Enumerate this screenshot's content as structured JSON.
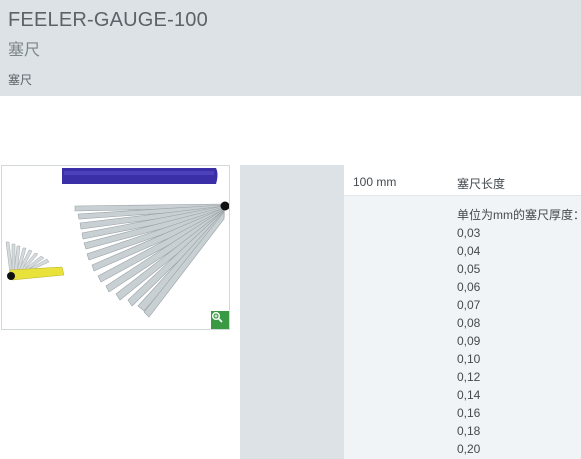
{
  "header": {
    "title": "FEELER-GAUGE-100",
    "subtitle": "塞尺",
    "category": "塞尺"
  },
  "spec": {
    "value": "100  mm",
    "label": "塞尺长度",
    "thickness_heading": "单位为mm的塞尺厚度：",
    "thickness_values": [
      "0,03",
      "0,04",
      "0,05",
      "0,06",
      "0,07",
      "0,08",
      "0,09",
      "0,10",
      "0,12",
      "0,14",
      "0,16",
      "0,18",
      "0,20"
    ]
  },
  "icons": {
    "zoom": "magnifier-icon"
  },
  "colors": {
    "header_bg": "#dde2e6",
    "zoom_button": "#3a9a44",
    "pouch": "#3b2fa8",
    "small_gauge_yellow": "#e8e23a"
  }
}
